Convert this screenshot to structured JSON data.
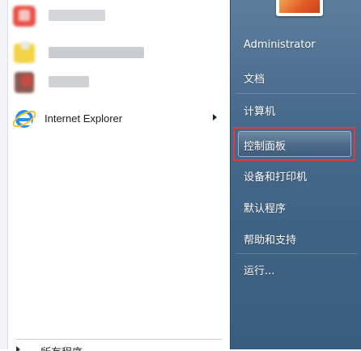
{
  "programs": [
    {
      "name": "program-1",
      "label": "",
      "icon": "blurred-app-icon",
      "colors": [
        "#e8524a",
        "#f4a19c"
      ]
    },
    {
      "name": "program-2",
      "label": "",
      "icon": "blurred-app-icon",
      "colors": [
        "#f3d54a",
        "#e8c93a"
      ]
    },
    {
      "name": "program-3",
      "label": "",
      "icon": "blurred-app-icon",
      "colors": [
        "#8a5a4e",
        "#c44b46"
      ]
    },
    {
      "name": "program-internet-explorer",
      "label": "Internet Explorer",
      "icon": "internet-explorer-icon"
    }
  ],
  "left_bottom_label": "所有程序",
  "right_items": {
    "user": "Administrator",
    "documents": "文档",
    "computer": "计算机",
    "control_panel": "控制面板",
    "devices_printers": "设备和打印机",
    "default_programs": "默认程序",
    "help_support": "帮助和支持",
    "run": "运行..."
  },
  "colors": {
    "right_pane": "#47698b",
    "highlight_border": "#e23a3a"
  }
}
